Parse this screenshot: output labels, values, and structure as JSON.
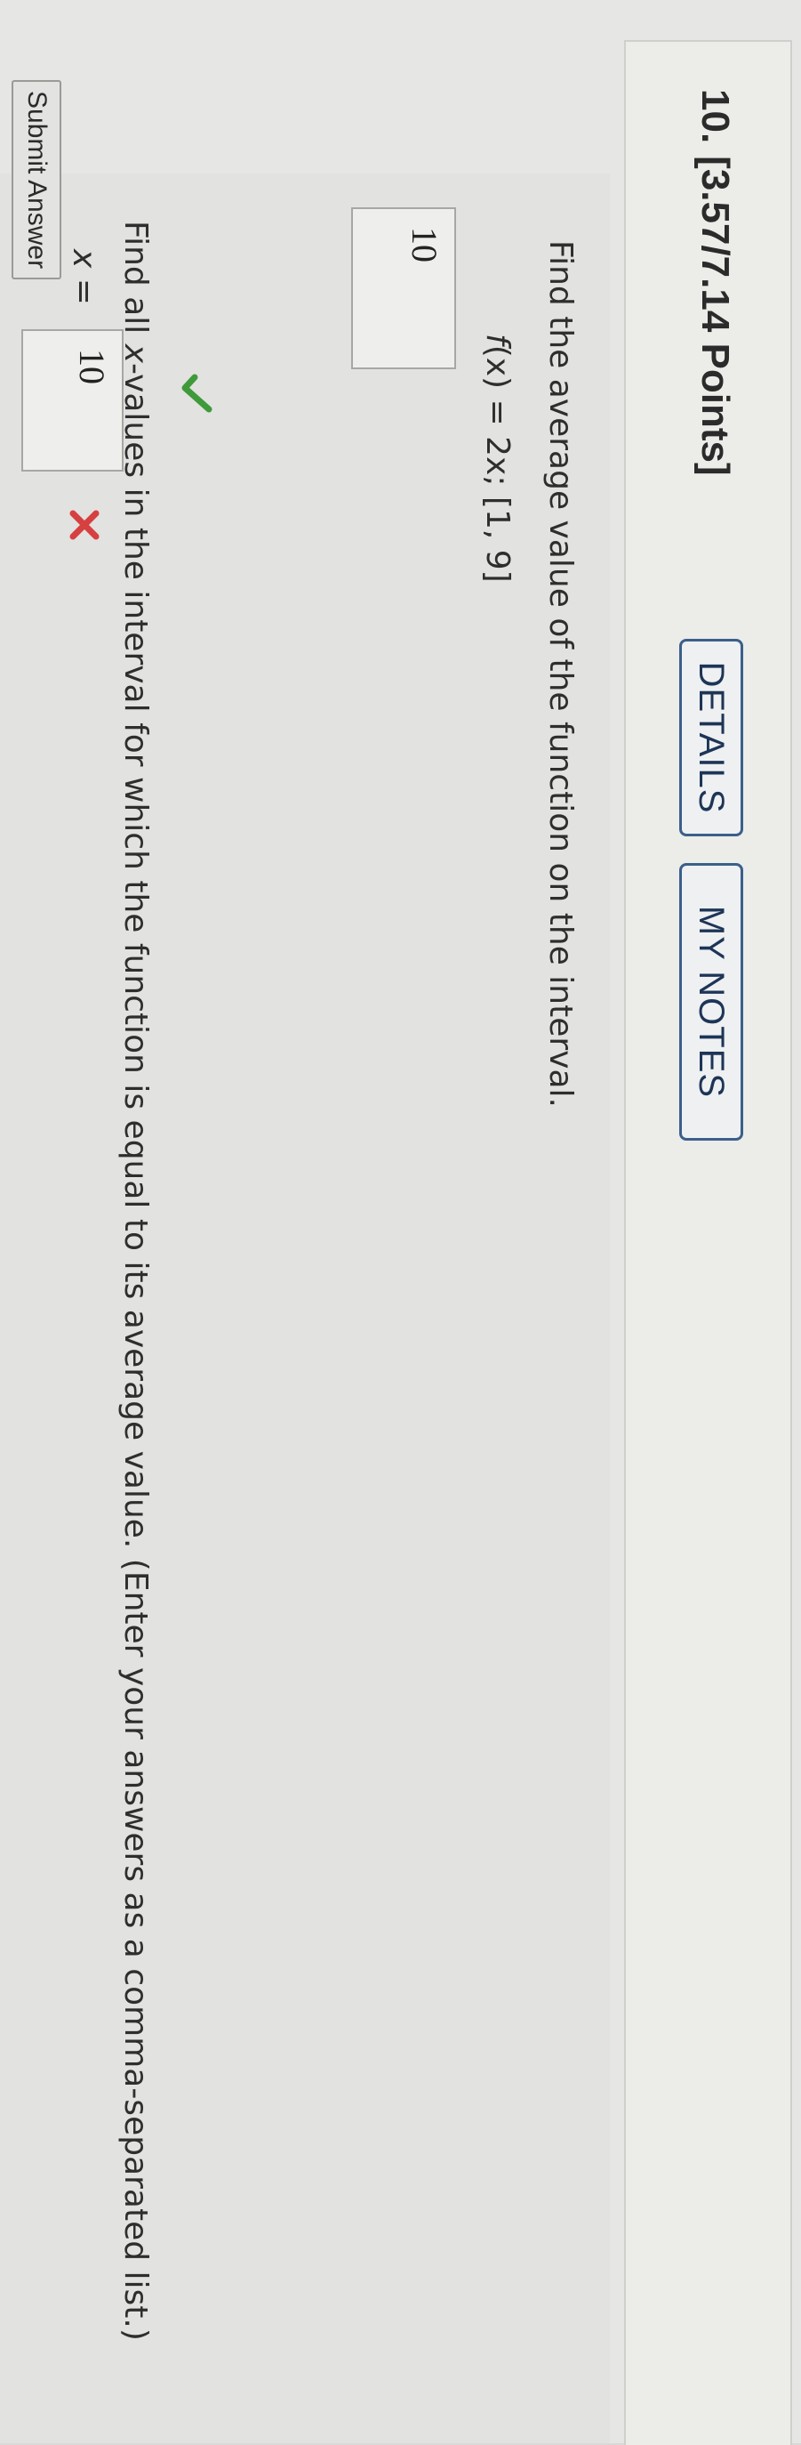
{
  "question": {
    "number": "10.",
    "points": "[3.57/7.14 Points]"
  },
  "buttons": {
    "details": "DETAILS",
    "my_notes": "MY NOTES",
    "submit": "Submit Answer"
  },
  "part1": {
    "prompt": "Find the average value of the function on the interval.",
    "function_name": "f",
    "function_rest": "(x) = 2x; [1, 9]",
    "answer": "10",
    "status": "correct"
  },
  "part2": {
    "prompt_start": "Find all ",
    "prompt_var": "x",
    "prompt_end": "-values in the interval for which the function is equal to its average value. (Enter your answers as a comma-separated list.)",
    "x_label": "x",
    "equals": " = ",
    "answer": "10",
    "status": "incorrect"
  },
  "colors": {
    "correct": "#3f9a3a",
    "incorrect": "#d64040",
    "button_border": "#3b5f8a"
  },
  "icons": {
    "correct": "checkmark-icon",
    "incorrect": "cross-icon"
  }
}
